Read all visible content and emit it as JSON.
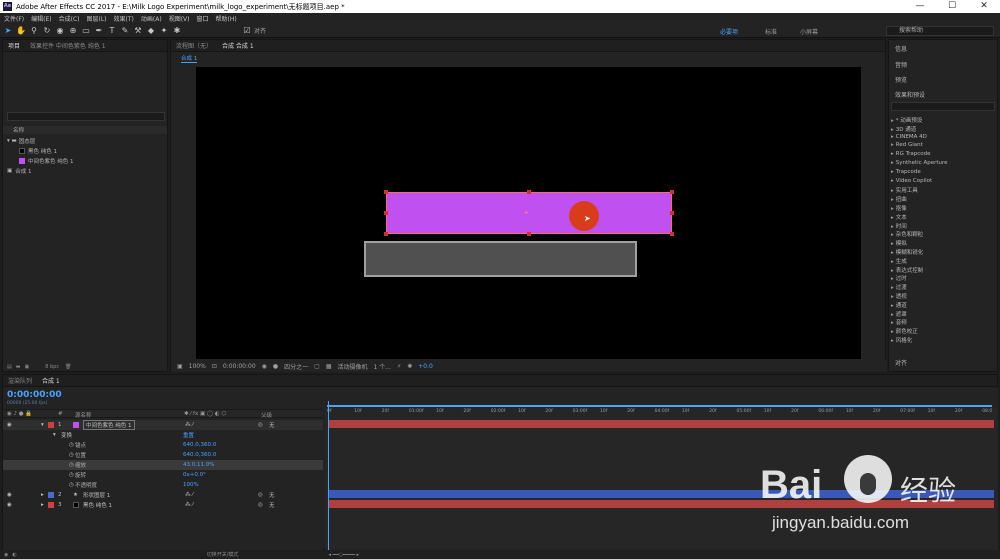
{
  "window": {
    "title": "Adobe After Effects CC 2017 - E:\\Milk Logo Experiment\\milk_logo_experiment\\无标题项目.aep *",
    "logo": "Ae",
    "minimize": "—",
    "maximize": "☐",
    "close": "✕"
  },
  "menu": [
    "文件(F)",
    "编辑(E)",
    "合成(C)",
    "图层(L)",
    "效果(T)",
    "动画(A)",
    "视图(V)",
    "窗口",
    "帮助(H)"
  ],
  "toolbar": {
    "align_label": "对齐",
    "workspaces": [
      "必要项",
      "标准",
      "小屏幕"
    ],
    "search_placeholder": "搜索帮助"
  },
  "project_panel": {
    "tabs": [
      "项目",
      "效果控件 中间色紫色 纯色 1"
    ],
    "name_header": "名称",
    "items": [
      {
        "name": "固态层",
        "type": "folder"
      },
      {
        "name": "黑色 纯色 1",
        "color": "#000000"
      },
      {
        "name": "中间色紫色 纯色 1",
        "color": "#c050f0"
      },
      {
        "name": "合成 1",
        "type": "comp"
      }
    ],
    "bpc": "8 bpc"
  },
  "viewer": {
    "tabs": [
      "流程图（无）",
      "合成 合成 1"
    ],
    "breadcrumb": "合成 1",
    "zoom": "100%",
    "timecode": "0:00:00:00",
    "resolution": "四分之一",
    "camera": "活动摄像机",
    "views": "1 个...",
    "exposure": "+0.0"
  },
  "right_panel": {
    "sections": [
      "信息",
      "音频",
      "预览",
      "效果和预设"
    ],
    "effects": [
      "* 动画预设",
      "3D 通道",
      "CINEMA 4D",
      "Red Giant",
      "RG Trapcode",
      "Synthetic Aperture",
      "Trapcode",
      "Video Copilot",
      "实用工具",
      "扭曲",
      "抠像",
      "文本",
      "时间",
      "杂色和颗粒",
      "模拟",
      "模糊和锐化",
      "生成",
      "表达式控制",
      "过时",
      "过渡",
      "透视",
      "通道",
      "遮罩",
      "音频",
      "颜色校正",
      "风格化"
    ],
    "bottom": "对齐"
  },
  "timeline": {
    "tabs": [
      "渲染队列",
      "合成 1"
    ],
    "timecode": "0:00:00:00",
    "timecode_sub": "00000 (25.00 fps)",
    "header_source": "源名称",
    "header_parent": "父级",
    "layers": [
      {
        "num": "1",
        "name": "中间色紫色 纯色 1",
        "color": "#c050f0",
        "parent": "无",
        "bar": "#b04040"
      },
      {
        "num": "2",
        "name": "形状图层 1",
        "color": "#4a6ad0",
        "parent": "无",
        "bar": "#3a58b8"
      },
      {
        "num": "3",
        "name": "黑色 纯色 1",
        "color": "#000000",
        "parent": "无",
        "bar": "#b04040"
      }
    ],
    "transform_label": "变换",
    "reset_label": "重置",
    "properties": [
      {
        "name": "锚点",
        "value": "640.0,360.0"
      },
      {
        "name": "位置",
        "value": "640.0,360.0"
      },
      {
        "name": "缩放",
        "value": "43.0,11.0%"
      },
      {
        "name": "旋转",
        "value": "0x+0.0°"
      },
      {
        "name": "不透明度",
        "value": "100%"
      }
    ],
    "ruler": [
      "0f",
      "10f",
      "20f",
      "01:00f",
      "10f",
      "20f",
      "02:00f",
      "10f",
      "20f",
      "03:00f",
      "10f",
      "20f",
      "04:00f",
      "10f",
      "20f",
      "05:00f",
      "10f",
      "20f",
      "06:00f",
      "10f",
      "20f",
      "07:00f",
      "10f",
      "20f",
      "08:0"
    ],
    "toggle_label": "切换开关/模式"
  },
  "watermark": {
    "brand": "Bai",
    "brand2": "经验",
    "url": "jingyan.baidu.com"
  }
}
